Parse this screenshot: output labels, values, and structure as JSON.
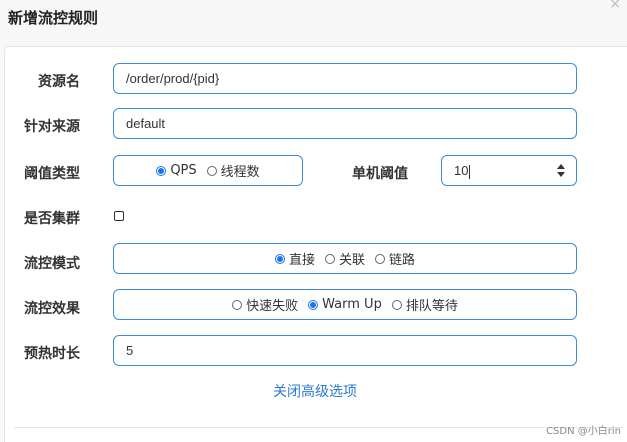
{
  "dialog": {
    "title": "新增流控规则",
    "close_glyph": "×"
  },
  "fields": {
    "resource": {
      "label": "资源名",
      "value": "/order/prod/{pid}"
    },
    "source": {
      "label": "针对来源",
      "value": "default"
    },
    "threshold_type": {
      "label": "阈值类型",
      "options": [
        {
          "label": "QPS",
          "selected": true
        },
        {
          "label": "线程数",
          "selected": false
        }
      ]
    },
    "single_threshold": {
      "label": "单机阈值",
      "value": "10"
    },
    "cluster": {
      "label": "是否集群",
      "checked": false
    },
    "flow_mode": {
      "label": "流控模式",
      "options": [
        {
          "label": "直接",
          "selected": true
        },
        {
          "label": "关联",
          "selected": false
        },
        {
          "label": "链路",
          "selected": false
        }
      ]
    },
    "flow_effect": {
      "label": "流控效果",
      "options": [
        {
          "label": "快速失败",
          "selected": false
        },
        {
          "label": "Warm Up",
          "selected": true
        },
        {
          "label": "排队等待",
          "selected": false
        }
      ]
    },
    "warmup": {
      "label": "预热时长",
      "value": "5"
    }
  },
  "advanced_toggle": "关闭高级选项",
  "watermark": "CSDN @小白rin",
  "colors": {
    "accent": "#3b8dd8",
    "radio": "#1a73e8",
    "link": "#2a7ad2"
  }
}
